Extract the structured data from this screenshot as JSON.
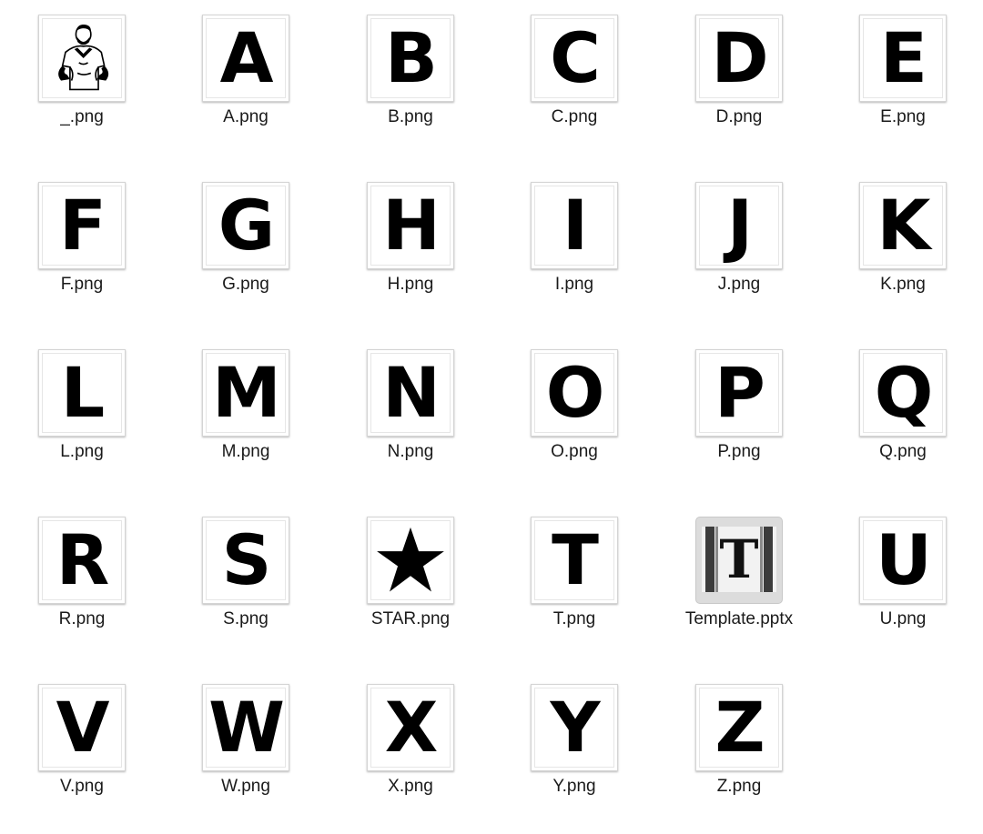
{
  "files": [
    {
      "name": "_.png",
      "kind": "photo",
      "icon": "man-silhouette-icon"
    },
    {
      "name": "A.png",
      "kind": "letter",
      "glyph": "A"
    },
    {
      "name": "B.png",
      "kind": "letter",
      "glyph": "B"
    },
    {
      "name": "C.png",
      "kind": "letter",
      "glyph": "C"
    },
    {
      "name": "D.png",
      "kind": "letter",
      "glyph": "D"
    },
    {
      "name": "E.png",
      "kind": "letter",
      "glyph": "E"
    },
    {
      "name": "F.png",
      "kind": "letter",
      "glyph": "F"
    },
    {
      "name": "G.png",
      "kind": "letter",
      "glyph": "G"
    },
    {
      "name": "H.png",
      "kind": "letter",
      "glyph": "H"
    },
    {
      "name": "I.png",
      "kind": "letter",
      "glyph": "I"
    },
    {
      "name": "J.png",
      "kind": "letter",
      "glyph": "J"
    },
    {
      "name": "K.png",
      "kind": "letter",
      "glyph": "K"
    },
    {
      "name": "L.png",
      "kind": "letter",
      "glyph": "L"
    },
    {
      "name": "M.png",
      "kind": "letter",
      "glyph": "M"
    },
    {
      "name": "N.png",
      "kind": "letter",
      "glyph": "N"
    },
    {
      "name": "O.png",
      "kind": "letter",
      "glyph": "O"
    },
    {
      "name": "P.png",
      "kind": "letter",
      "glyph": "P"
    },
    {
      "name": "Q.png",
      "kind": "letter",
      "glyph": "Q"
    },
    {
      "name": "R.png",
      "kind": "letter",
      "glyph": "R"
    },
    {
      "name": "S.png",
      "kind": "letter",
      "glyph": "S"
    },
    {
      "name": "STAR.png",
      "kind": "star",
      "icon": "star-icon"
    },
    {
      "name": "T.png",
      "kind": "letter",
      "glyph": "T"
    },
    {
      "name": "Template.pptx",
      "kind": "pptx",
      "glyph": "T",
      "icon": "powerpoint-document-icon"
    },
    {
      "name": "U.png",
      "kind": "letter",
      "glyph": "U"
    },
    {
      "name": "V.png",
      "kind": "letter",
      "glyph": "V"
    },
    {
      "name": "W.png",
      "kind": "letter",
      "glyph": "W"
    },
    {
      "name": "X.png",
      "kind": "letter",
      "glyph": "X"
    },
    {
      "name": "Y.png",
      "kind": "letter",
      "glyph": "Y"
    },
    {
      "name": "Z.png",
      "kind": "letter",
      "glyph": "Z"
    }
  ]
}
